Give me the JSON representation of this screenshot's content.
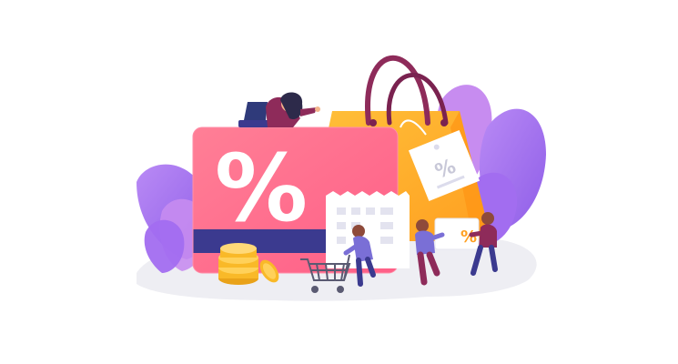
{
  "illustration": {
    "card_symbol": "%",
    "tag_symbol": "%",
    "box_symbol": "%"
  },
  "colors": {
    "card_pink": "#ff6f8e",
    "card_stripe": "#3b3a8f",
    "bag_orange": "#ffb12b",
    "leaf_purple": "#a26df0",
    "leaf_violet": "#c78cf0",
    "coin_gold": "#f9b928",
    "ground_gray": "#eeeef3",
    "receipt_white": "#ffffff"
  },
  "icons": [
    "percent-card",
    "shopping-bag",
    "price-tag",
    "receipt",
    "coin-stack",
    "shopping-cart",
    "gift-box",
    "laptop"
  ]
}
